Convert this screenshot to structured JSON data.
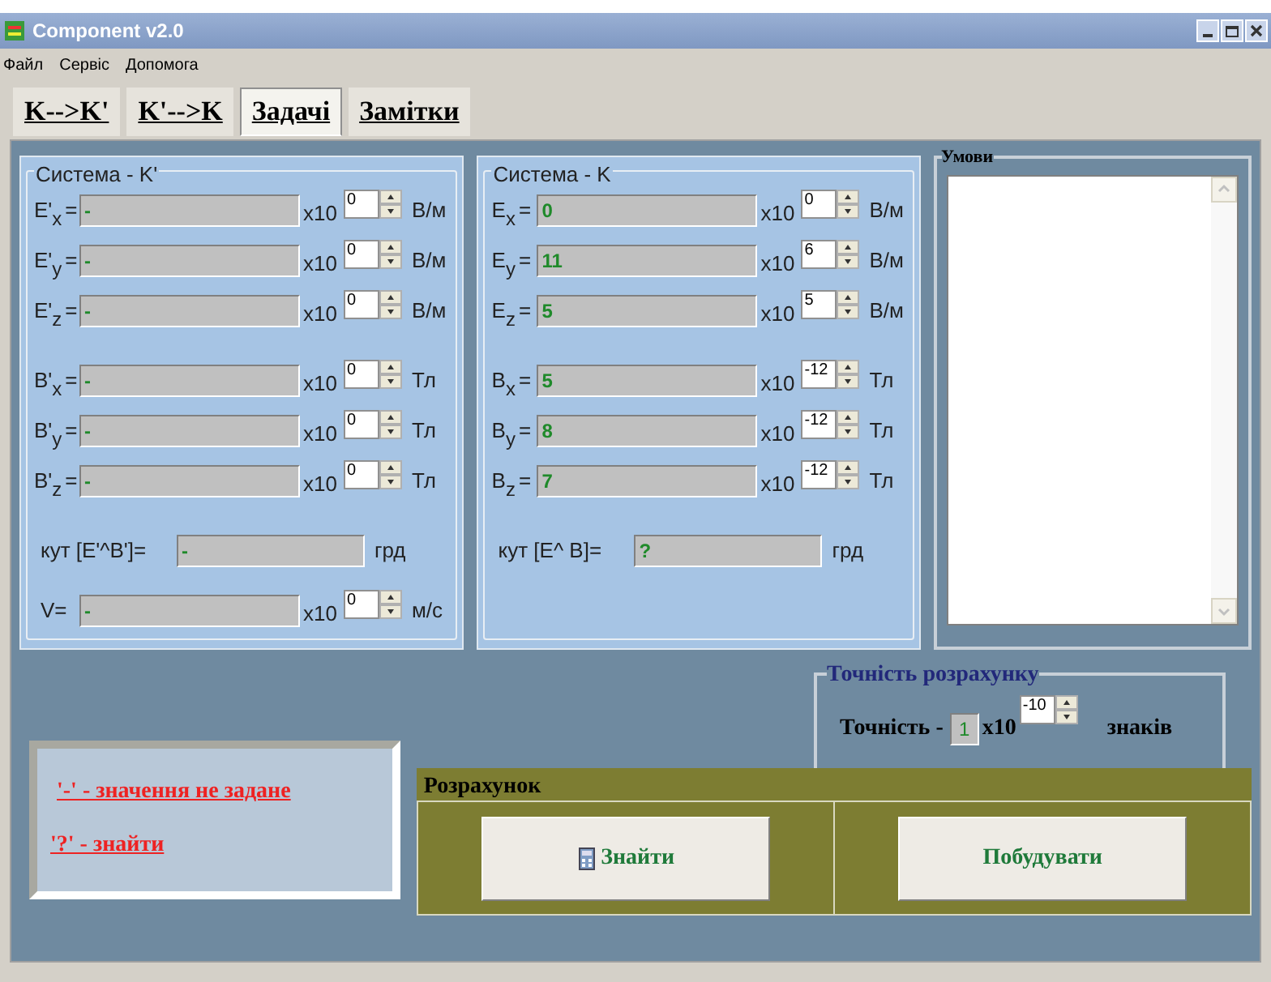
{
  "window": {
    "title": "Component v2.0"
  },
  "menu": [
    "Файл",
    "Сервіс",
    "Допомога"
  ],
  "tabs": [
    {
      "label": "K-->K'",
      "selected": false
    },
    {
      "label": "K'-->K",
      "selected": false
    },
    {
      "label": "Задачі",
      "selected": true
    },
    {
      "label": "Замітки",
      "selected": false
    }
  ],
  "systems": [
    {
      "title": "Система - K'",
      "e_fields": [
        {
          "symbol": "E'",
          "subscript": "x",
          "sign": "=",
          "value": "-",
          "multiplier": "x10",
          "exponent": "0",
          "unit": "В/м"
        },
        {
          "symbol": "E'",
          "subscript": "y",
          "sign": "=",
          "value": "-",
          "multiplier": "x10",
          "exponent": "0",
          "unit": "В/м"
        },
        {
          "symbol": "E'",
          "subscript": "z",
          "sign": "=",
          "value": "-",
          "multiplier": "x10",
          "exponent": "0",
          "unit": "В/м"
        }
      ],
      "b_fields": [
        {
          "symbol": "B'",
          "subscript": "x",
          "sign": "=",
          "value": "-",
          "multiplier": "x10",
          "exponent": "0",
          "unit": "Тл"
        },
        {
          "symbol": "B'",
          "subscript": "y",
          "sign": "=",
          "value": "-",
          "multiplier": "x10",
          "exponent": "0",
          "unit": "Тл"
        },
        {
          "symbol": "B'",
          "subscript": "z",
          "sign": "=",
          "value": "-",
          "multiplier": "x10",
          "exponent": "0",
          "unit": "Тл"
        }
      ],
      "angle": {
        "label": "кут [E'^B']=",
        "value": "-",
        "unit": "грд"
      },
      "velocity": {
        "label": "V=",
        "value": "-",
        "multiplier": "x10",
        "exponent": "0",
        "unit": "м/с"
      }
    },
    {
      "title": "Система - K",
      "e_fields": [
        {
          "symbol": "E",
          "subscript": "x",
          "sign": "=",
          "value": "0",
          "multiplier": "x10",
          "exponent": "0",
          "unit": "В/м"
        },
        {
          "symbol": "E",
          "subscript": "y",
          "sign": "=",
          "value": "11",
          "multiplier": "x10",
          "exponent": "6",
          "unit": "В/м"
        },
        {
          "symbol": "E",
          "subscript": "z",
          "sign": "=",
          "value": "5",
          "multiplier": "x10",
          "exponent": "5",
          "unit": "В/м"
        }
      ],
      "b_fields": [
        {
          "symbol": "B",
          "subscript": "x",
          "sign": "=",
          "value": "5",
          "multiplier": "x10",
          "exponent": "-12",
          "unit": "Тл"
        },
        {
          "symbol": "B",
          "subscript": "y",
          "sign": "=",
          "value": "8",
          "multiplier": "x10",
          "exponent": "-12",
          "unit": "Тл"
        },
        {
          "symbol": "B",
          "subscript": "z",
          "sign": "=",
          "value": "7",
          "multiplier": "x10",
          "exponent": "-12",
          "unit": "Тл"
        }
      ],
      "angle": {
        "label": "кут [E^ B]=",
        "value": "?",
        "unit": "грд"
      }
    }
  ],
  "conditions": {
    "title": "Умови"
  },
  "legend": [
    "'-' - значення не задане",
    "'?' - знайти"
  ],
  "precision": {
    "title": "Точність розрахунку",
    "label": "Точність -",
    "value": "1",
    "multiplier": "x10",
    "exponent": "-10",
    "unit": "знаків"
  },
  "calculation": {
    "title": "Розрахунок",
    "buttons": [
      {
        "label": "Знайти",
        "kind": "find"
      },
      {
        "label": "Побудувати",
        "kind": "plot"
      }
    ]
  }
}
